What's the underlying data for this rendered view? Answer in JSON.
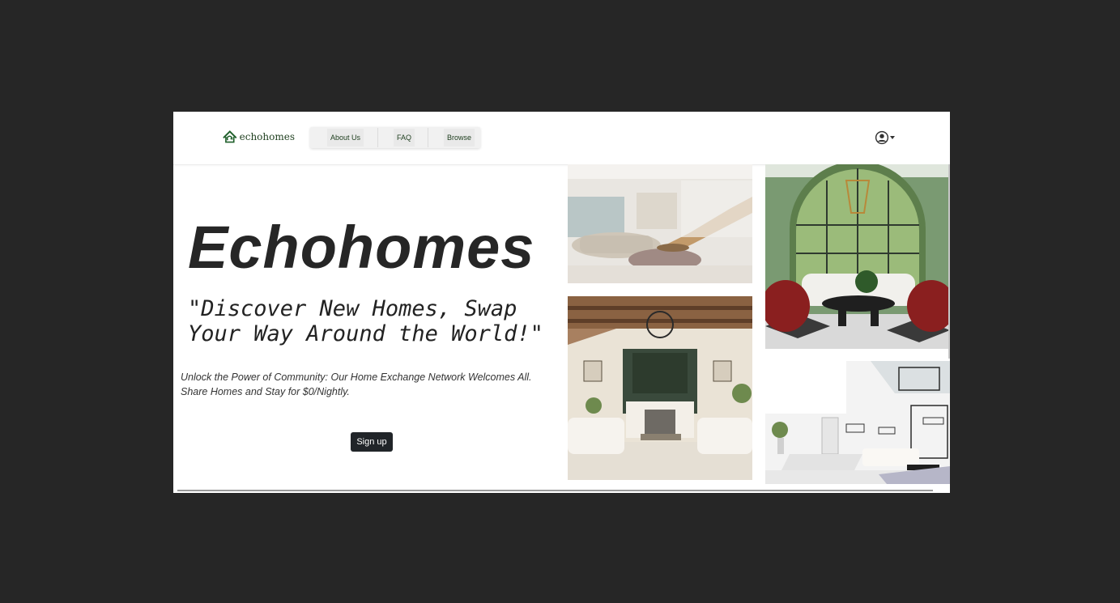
{
  "brand": {
    "name": "echohomes"
  },
  "nav": {
    "about": "About Us",
    "faq": "FAQ",
    "browse": "Browse"
  },
  "hero": {
    "title": "Echohomes",
    "tagline": "\"Discover New Homes, Swap Your Way Around the World!\"",
    "description": "Unlock the Power of Community: Our Home Exchange Network Welcomes All. Share Homes and Stay for $0/Nightly.",
    "cta": "Sign up"
  },
  "colors": {
    "background": "#262626",
    "brand_green": "#1f5f2a",
    "button_dark": "#212529"
  },
  "icons": [
    "home-logo-icon",
    "user-circle-icon",
    "caret-down-icon"
  ]
}
